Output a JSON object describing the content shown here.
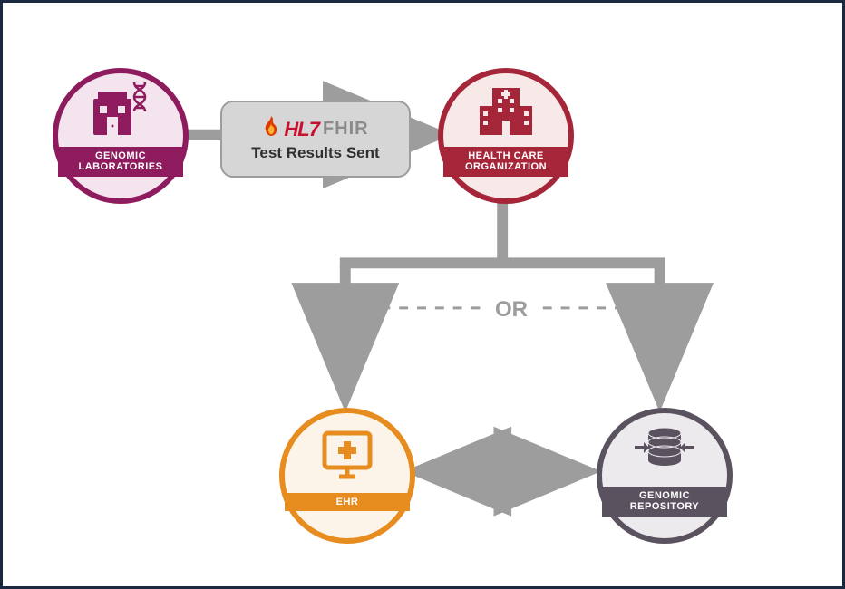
{
  "nodes": {
    "lab": {
      "label": "GENOMIC LABORATORIES",
      "icon": "lab-building-dna-icon",
      "color": "#8e1b5d"
    },
    "hco": {
      "label": "HEALTH CARE ORGANIZATION",
      "icon": "hospital-icon",
      "color": "#a62639"
    },
    "ehr": {
      "label": "EHR",
      "icon": "monitor-plus-icon",
      "color": "#e78c1e"
    },
    "repo": {
      "label": "GENOMIC REPOSITORY",
      "icon": "database-icon",
      "color": "#5a525f"
    }
  },
  "message_box": {
    "logo_prefix": "HL7",
    "logo_suffix": "FHIR",
    "caption": "Test Results Sent"
  },
  "branch_label": "OR",
  "colors": {
    "arrow": "#9d9d9d",
    "frame": "#1a2840"
  }
}
